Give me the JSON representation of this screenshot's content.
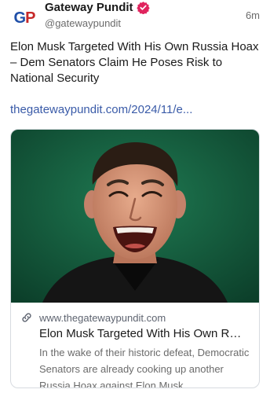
{
  "post": {
    "author": {
      "display_name": "Gateway Pundit",
      "handle": "@gatewaypundit",
      "avatar_logo": "GP",
      "verified_icon": "verified-badge-icon",
      "verified_color": "#e0245e"
    },
    "timestamp": "6m",
    "text": "Elon Musk Targeted With His Own Russia Hoax – Dem Senators Claim He Poses Risk to National Security",
    "link_text": "thegatewaypundit.com/2024/11/e...",
    "link_color": "#3a5ba8"
  },
  "card": {
    "domain": "www.thegatewaypundit.com",
    "domain_icon": "link-icon",
    "title": "Elon Musk Targeted With His Own Ru...",
    "description": "In the wake of their historic defeat, Democratic Senators are already cooking up another Russia Hoax against Elon Musk."
  }
}
